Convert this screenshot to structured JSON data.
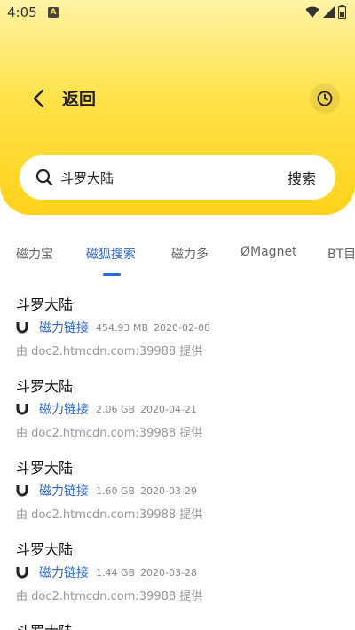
{
  "status": {
    "time": "4:05",
    "notification_glyph": "A"
  },
  "nav": {
    "back_label": "返回"
  },
  "search": {
    "value": "斗罗大陆",
    "button_label": "搜索"
  },
  "tabs": [
    {
      "label": "磁力宝",
      "active": false
    },
    {
      "label": "磁狐搜索",
      "active": true
    },
    {
      "label": "磁力多",
      "active": false
    },
    {
      "label": "ØMagnet",
      "active": false
    },
    {
      "label": "BT目",
      "active": false
    }
  ],
  "results": [
    {
      "title": "斗罗大陆",
      "link_label": "磁力链接",
      "size": "454.93 MB",
      "date": "2020-02-08",
      "source": "由 doc2.htmcdn.com:39988 提供"
    },
    {
      "title": "斗罗大陆",
      "link_label": "磁力链接",
      "size": "2.06 GB",
      "date": "2020-04-21",
      "source": "由 doc2.htmcdn.com:39988 提供"
    },
    {
      "title": "斗罗大陆",
      "link_label": "磁力链接",
      "size": "1.60 GB",
      "date": "2020-03-29",
      "source": "由 doc2.htmcdn.com:39988 提供"
    },
    {
      "title": "斗罗大陆",
      "link_label": "磁力链接",
      "size": "1.44 GB",
      "date": "2020-03-28",
      "source": "由 doc2.htmcdn.com:39988 提供"
    },
    {
      "title": "斗罗大陆"
    }
  ],
  "colors": {
    "accent": "#2e67d8",
    "header_yellow": "#ffd21a"
  }
}
